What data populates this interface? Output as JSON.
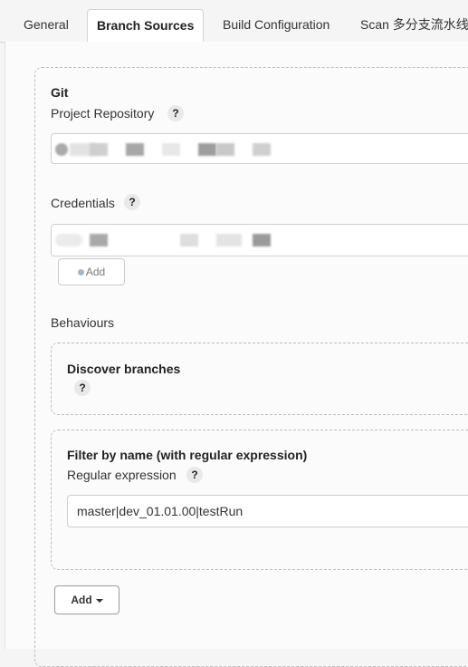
{
  "tabs": [
    {
      "label": "General"
    },
    {
      "label": "Branch Sources"
    },
    {
      "label": "Build Configuration"
    },
    {
      "label": "Scan 多分支流水线"
    }
  ],
  "source": {
    "title": "Git",
    "repo_label": "Project Repository",
    "credentials_label": "Credentials",
    "add_credentials_label": "Add",
    "help_text": "?"
  },
  "behaviours": {
    "label": "Behaviours",
    "discover_title": "Discover branches",
    "filter_title": "Filter by name (with regular expression)",
    "regex_label": "Regular expression",
    "regex_value": "master|dev_01.01.00|testRun",
    "add_label": "Add"
  }
}
